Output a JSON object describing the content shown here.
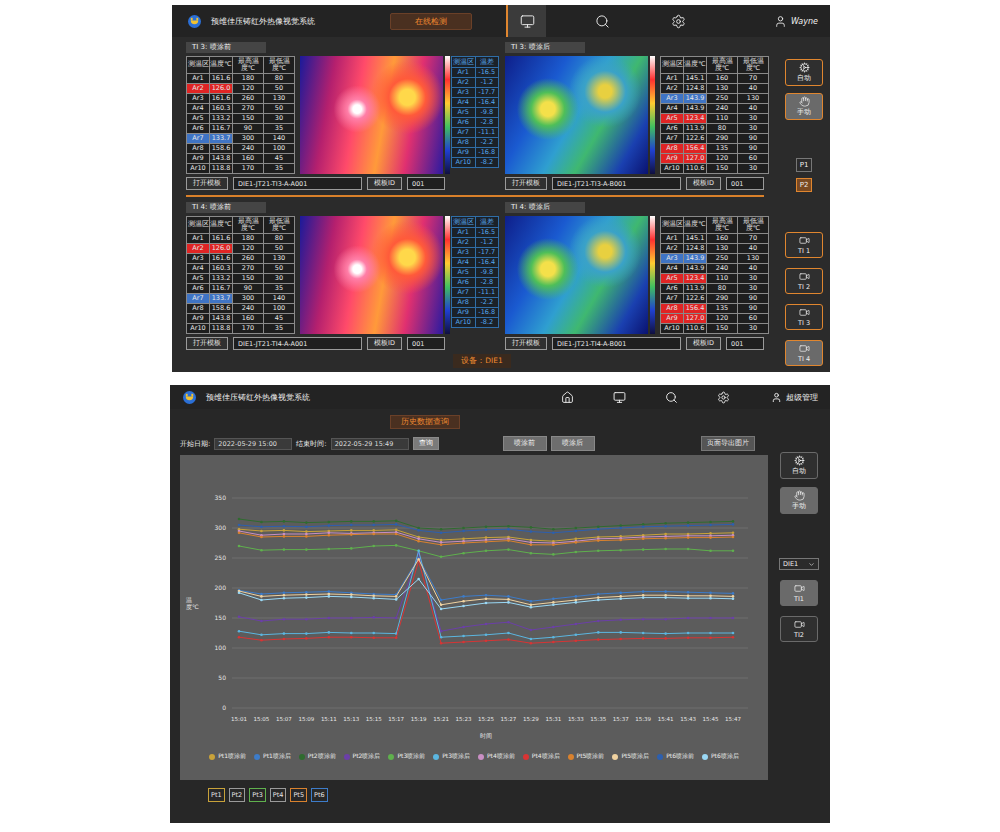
{
  "top": {
    "header": {
      "title": "预维佳压铸红外热像视觉系统",
      "mode_button": "在线检测",
      "nav": [
        {
          "selected": true
        },
        {
          "selected": false
        },
        {
          "selected": false
        }
      ],
      "user": "Wayne"
    },
    "sections": [
      {
        "before": {
          "title": "TI 3: 喷涂前",
          "columns": [
            "测温区",
            "温度℃",
            "最高温度℃",
            "最低温度℃"
          ],
          "rows": [
            {
              "zone": "Ar1",
              "temp": "161.6",
              "max": "180",
              "min": "80",
              "alarm": "none"
            },
            {
              "zone": "Ar2",
              "temp": "126.0",
              "max": "120",
              "min": "50",
              "alarm": "high"
            },
            {
              "zone": "Ar3",
              "temp": "161.6",
              "max": "260",
              "min": "130",
              "alarm": "none"
            },
            {
              "zone": "Ar4",
              "temp": "160.3",
              "max": "270",
              "min": "50",
              "alarm": "none"
            },
            {
              "zone": "Ar5",
              "temp": "133.2",
              "max": "150",
              "min": "30",
              "alarm": "none"
            },
            {
              "zone": "Ar6",
              "temp": "116.7",
              "max": "90",
              "min": "35",
              "alarm": "none"
            },
            {
              "zone": "Ar7",
              "temp": "133.7",
              "max": "300",
              "min": "140",
              "alarm": "low"
            },
            {
              "zone": "Ar8",
              "temp": "158.6",
              "max": "240",
              "min": "100",
              "alarm": "none"
            },
            {
              "zone": "Ar9",
              "temp": "143.8",
              "max": "160",
              "min": "45",
              "alarm": "none"
            },
            {
              "zone": "Ar10",
              "temp": "118.8",
              "max": "170",
              "min": "35",
              "alarm": "none"
            }
          ],
          "open_button": "打开模板",
          "template": "DIE1-JT21-TI3-A-A001",
          "id_label": "模板ID",
          "id": "001"
        },
        "diff": {
          "columns": [
            "测温区",
            "温差"
          ],
          "rows": [
            {
              "zone": "Ar1",
              "delta": "-16.5"
            },
            {
              "zone": "Ar2",
              "delta": "-1.2"
            },
            {
              "zone": "Ar3",
              "delta": "-17.7"
            },
            {
              "zone": "Ar4",
              "delta": "-16.4"
            },
            {
              "zone": "Ar5",
              "delta": "-9.8"
            },
            {
              "zone": "Ar6",
              "delta": "-2.8"
            },
            {
              "zone": "Ar7",
              "delta": "-11.1"
            },
            {
              "zone": "Ar8",
              "delta": "-2.2"
            },
            {
              "zone": "Ar9",
              "delta": "-16.8"
            },
            {
              "zone": "Ar10",
              "delta": "-8.2"
            }
          ]
        },
        "after": {
          "title": "TI 3: 喷涂后",
          "columns": [
            "测温区",
            "温度℃",
            "最高温度℃",
            "最低温度℃"
          ],
          "rows": [
            {
              "zone": "Ar1",
              "temp": "145.1",
              "max": "160",
              "min": "70",
              "alarm": "none"
            },
            {
              "zone": "Ar2",
              "temp": "124.8",
              "max": "130",
              "min": "40",
              "alarm": "none"
            },
            {
              "zone": "Ar3",
              "temp": "143.9",
              "max": "250",
              "min": "130",
              "alarm": "low"
            },
            {
              "zone": "Ar4",
              "temp": "143.9",
              "max": "240",
              "min": "40",
              "alarm": "none"
            },
            {
              "zone": "Ar5",
              "temp": "123.4",
              "max": "110",
              "min": "30",
              "alarm": "high"
            },
            {
              "zone": "Ar6",
              "temp": "113.9",
              "max": "80",
              "min": "30",
              "alarm": "none"
            },
            {
              "zone": "Ar7",
              "temp": "122.6",
              "max": "290",
              "min": "90",
              "alarm": "none"
            },
            {
              "zone": "Ar8",
              "temp": "156.4",
              "max": "135",
              "min": "90",
              "alarm": "high"
            },
            {
              "zone": "Ar9",
              "temp": "127.0",
              "max": "120",
              "min": "60",
              "alarm": "high"
            },
            {
              "zone": "Ar10",
              "temp": "110.6",
              "max": "150",
              "min": "30",
              "alarm": "none"
            }
          ],
          "open_button": "打开模板",
          "template": "DIE1-JT21-TI3-A-B001",
          "id_label": "模板ID",
          "id": "001"
        }
      },
      {
        "before": {
          "title": "TI 4: 喷涂前",
          "columns": [
            "测温区",
            "温度℃",
            "最高温度℃",
            "最低温度℃"
          ],
          "rows": [
            {
              "zone": "Ar1",
              "temp": "161.6",
              "max": "180",
              "min": "80",
              "alarm": "none"
            },
            {
              "zone": "Ar2",
              "temp": "126.0",
              "max": "120",
              "min": "50",
              "alarm": "high"
            },
            {
              "zone": "Ar3",
              "temp": "161.6",
              "max": "260",
              "min": "130",
              "alarm": "none"
            },
            {
              "zone": "Ar4",
              "temp": "160.3",
              "max": "270",
              "min": "50",
              "alarm": "none"
            },
            {
              "zone": "Ar5",
              "temp": "133.2",
              "max": "150",
              "min": "30",
              "alarm": "none"
            },
            {
              "zone": "Ar6",
              "temp": "116.7",
              "max": "90",
              "min": "35",
              "alarm": "none"
            },
            {
              "zone": "Ar7",
              "temp": "133.7",
              "max": "300",
              "min": "140",
              "alarm": "low"
            },
            {
              "zone": "Ar8",
              "temp": "158.6",
              "max": "240",
              "min": "100",
              "alarm": "none"
            },
            {
              "zone": "Ar9",
              "temp": "143.8",
              "max": "160",
              "min": "45",
              "alarm": "none"
            },
            {
              "zone": "Ar10",
              "temp": "118.8",
              "max": "170",
              "min": "35",
              "alarm": "none"
            }
          ],
          "open_button": "打开模板",
          "template": "DIE1-JT21-TI4-A-A001",
          "id_label": "模板ID",
          "id": "001"
        },
        "diff": {
          "columns": [
            "测温区",
            "温差"
          ],
          "rows": [
            {
              "zone": "Ar1",
              "delta": "-16.5"
            },
            {
              "zone": "Ar2",
              "delta": "-1.2"
            },
            {
              "zone": "Ar3",
              "delta": "-17.7"
            },
            {
              "zone": "Ar4",
              "delta": "-16.4"
            },
            {
              "zone": "Ar5",
              "delta": "-9.8"
            },
            {
              "zone": "Ar6",
              "delta": "-2.8"
            },
            {
              "zone": "Ar7",
              "delta": "-11.1"
            },
            {
              "zone": "Ar8",
              "delta": "-2.2"
            },
            {
              "zone": "Ar9",
              "delta": "-16.8"
            },
            {
              "zone": "Ar10",
              "delta": "-8.2"
            }
          ]
        },
        "after": {
          "title": "TI 4: 喷涂后",
          "columns": [
            "测温区",
            "温度℃",
            "最高温度℃",
            "最低温度℃"
          ],
          "rows": [
            {
              "zone": "Ar1",
              "temp": "145.1",
              "max": "160",
              "min": "70",
              "alarm": "none"
            },
            {
              "zone": "Ar2",
              "temp": "124.8",
              "max": "130",
              "min": "40",
              "alarm": "none"
            },
            {
              "zone": "Ar3",
              "temp": "143.9",
              "max": "250",
              "min": "130",
              "alarm": "low"
            },
            {
              "zone": "Ar4",
              "temp": "143.9",
              "max": "240",
              "min": "40",
              "alarm": "none"
            },
            {
              "zone": "Ar5",
              "temp": "123.4",
              "max": "110",
              "min": "30",
              "alarm": "high"
            },
            {
              "zone": "Ar6",
              "temp": "113.9",
              "max": "80",
              "min": "30",
              "alarm": "none"
            },
            {
              "zone": "Ar7",
              "temp": "122.6",
              "max": "290",
              "min": "90",
              "alarm": "none"
            },
            {
              "zone": "Ar8",
              "temp": "156.4",
              "max": "135",
              "min": "90",
              "alarm": "high"
            },
            {
              "zone": "Ar9",
              "temp": "127.0",
              "max": "120",
              "min": "60",
              "alarm": "high"
            },
            {
              "zone": "Ar10",
              "temp": "110.6",
              "max": "150",
              "min": "30",
              "alarm": "none"
            }
          ],
          "open_button": "打开模板",
          "template": "DIE1-JT21-TI4-A-B001",
          "id_label": "模板ID",
          "id": "001"
        }
      }
    ],
    "sidebar": {
      "modes": [
        {
          "label": "自动",
          "selected": false
        },
        {
          "label": "手动",
          "selected": true
        }
      ],
      "pages": [
        {
          "label": "P1",
          "selected": false
        },
        {
          "label": "P2",
          "selected": true
        }
      ],
      "cameras": [
        {
          "label": "TI 1",
          "selected": false
        },
        {
          "label": "TI 2",
          "selected": false
        },
        {
          "label": "TI 3",
          "selected": false
        },
        {
          "label": "TI 4",
          "selected": true
        }
      ]
    },
    "footer": "设备：DIE1"
  },
  "bottom": {
    "header": {
      "title": "预维佳压铸红外热像视觉系统",
      "nav": [
        {
          "selected": false
        },
        {
          "selected": false
        },
        {
          "selected": false
        },
        {
          "selected": false
        }
      ],
      "user": "超级管理"
    },
    "page_title": "历史数据查询",
    "query": {
      "start_label": "开始日期:",
      "start": "2022-05-29 15:00",
      "end_label": "结束时间:",
      "end": "2022-05-29 15:49",
      "button": "查询"
    },
    "filters": [
      {
        "label": "喷涂前",
        "selected": false
      },
      {
        "label": "喷涂后",
        "selected": false
      }
    ],
    "export_button": "页面导出图片",
    "chart": {
      "y_title": "温度℃",
      "y_ticks": [
        "0",
        "50",
        "100",
        "150",
        "200",
        "250",
        "300",
        "350"
      ],
      "x_ticks": [
        "15:01",
        "15:05",
        "15:07",
        "15:09",
        "15:11",
        "15:13",
        "15:15",
        "15:17",
        "15:19",
        "15:21",
        "15:23",
        "15:25",
        "15:27",
        "15:29",
        "15:31",
        "15:33",
        "15:35",
        "15:37",
        "15:39",
        "15:41",
        "15:43",
        "15:45",
        "15:47"
      ],
      "x_title": "时间",
      "series": [
        {
          "name": "Pt1喷涂前",
          "color": "#c8a23a",
          "values": [
            298,
            295,
            296,
            294,
            295,
            296,
            296,
            297,
            285,
            280,
            282,
            284,
            285,
            280,
            278,
            282,
            285,
            286,
            288,
            290,
            290,
            291,
            292
          ]
        },
        {
          "name": "Pt1喷涂后",
          "color": "#3d7cc9",
          "values": [
            196,
            190,
            192,
            193,
            194,
            192,
            190,
            189,
            250,
            180,
            186,
            188,
            186,
            178,
            182,
            186,
            190,
            192,
            194,
            194,
            193,
            192,
            191
          ]
        },
        {
          "name": "Pt2喷涂前",
          "color": "#2f6b2f",
          "values": [
            315,
            310,
            311,
            309,
            310,
            311,
            311,
            312,
            300,
            298,
            300,
            302,
            303,
            301,
            298,
            300,
            302,
            304,
            306,
            308,
            309,
            310,
            311
          ]
        },
        {
          "name": "Pt2喷涂后",
          "color": "#6b3fa8",
          "values": [
            152,
            145,
            148,
            148,
            150,
            150,
            151,
            150,
            258,
            128,
            135,
            140,
            143,
            130,
            135,
            140,
            145,
            147,
            148,
            148,
            150,
            150,
            150
          ]
        },
        {
          "name": "Pt3喷涂前",
          "color": "#5fb04d",
          "values": [
            270,
            263,
            264,
            264,
            265,
            266,
            270,
            271,
            262,
            252,
            258,
            262,
            264,
            258,
            256,
            260,
            262,
            263,
            264,
            265,
            265,
            262,
            262
          ]
        },
        {
          "name": "Pt3喷涂后",
          "color": "#5bb6e0",
          "values": [
            128,
            122,
            124,
            124,
            126,
            125,
            125,
            124,
            262,
            118,
            120,
            122,
            125,
            115,
            118,
            122,
            126,
            126,
            125,
            124,
            125,
            125,
            125
          ]
        },
        {
          "name": "Pt4喷涂前",
          "color": "#c98fc4",
          "values": [
            295,
            288,
            290,
            290,
            292,
            291,
            292,
            293,
            282,
            276,
            278,
            280,
            282,
            276,
            275,
            278,
            282,
            283,
            285,
            286,
            287,
            287,
            288
          ]
        },
        {
          "name": "Pt4喷涂后",
          "color": "#d93434",
          "values": [
            118,
            113,
            115,
            116,
            118,
            118,
            117,
            117,
            245,
            108,
            110,
            112,
            114,
            108,
            110,
            112,
            114,
            115,
            116,
            116,
            117,
            117,
            118
          ]
        },
        {
          "name": "Pt5喷涂前",
          "color": "#d9822e",
          "values": [
            292,
            285,
            286,
            286,
            288,
            289,
            290,
            290,
            278,
            272,
            275,
            277,
            279,
            272,
            272,
            276,
            279,
            280,
            282,
            283,
            284,
            284,
            285
          ]
        },
        {
          "name": "Pt5喷涂后",
          "color": "#f0d2a0",
          "values": [
            195,
            186,
            188,
            189,
            190,
            189,
            187,
            186,
            248,
            172,
            178,
            182,
            181,
            172,
            176,
            180,
            184,
            186,
            188,
            188,
            187,
            187,
            186
          ]
        },
        {
          "name": "Pt6喷涂前",
          "color": "#2d5fae",
          "values": [
            305,
            302,
            303,
            302,
            304,
            305,
            305,
            306,
            296,
            292,
            295,
            297,
            298,
            294,
            292,
            295,
            298,
            300,
            302,
            303,
            304,
            305,
            306
          ]
        },
        {
          "name": "Pt6喷涂后",
          "color": "#9ad8f5",
          "values": [
            192,
            180,
            183,
            184,
            186,
            185,
            183,
            181,
            215,
            165,
            170,
            175,
            176,
            168,
            172,
            176,
            180,
            182,
            184,
            184,
            183,
            183,
            182
          ]
        }
      ]
    },
    "points": [
      {
        "label": "Pt1",
        "color": "#c8a23a"
      },
      {
        "label": "Pt2",
        "color": "#9a9a9a"
      },
      {
        "label": "Pt3",
        "color": "#5fb04d"
      },
      {
        "label": "Pt4",
        "color": "#9a9a9a"
      },
      {
        "label": "Pt5",
        "color": "#d9822e"
      },
      {
        "label": "Pt6",
        "color": "#3d7cc9"
      }
    ],
    "sidebar": {
      "modes": [
        {
          "label": "自动",
          "selected": false
        },
        {
          "label": "手动",
          "selected": true
        }
      ],
      "device": "DIE1",
      "cameras": [
        {
          "label": "TI1",
          "selected": true
        },
        {
          "label": "TI2",
          "selected": false
        }
      ]
    }
  }
}
